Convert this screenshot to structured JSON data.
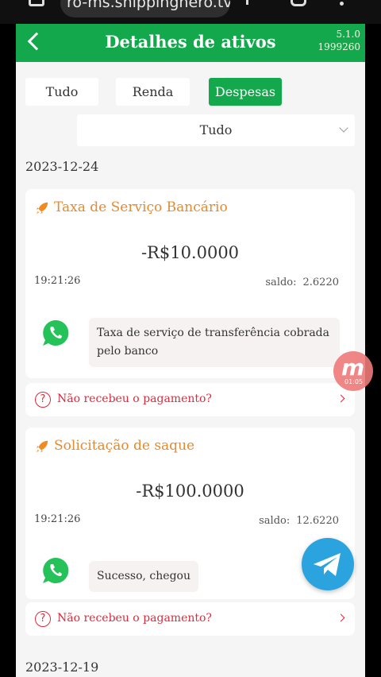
{
  "browser": {
    "url": "ro-ms.shippinghero.tv/#"
  },
  "header": {
    "title": "Detalhes de ativos",
    "version": "5.1.0",
    "build": "1999260"
  },
  "tabs": [
    {
      "label": "Tudo",
      "active": false
    },
    {
      "label": "Renda",
      "active": false
    },
    {
      "label": "Despesas",
      "active": true
    }
  ],
  "filter": {
    "selected": "Tudo"
  },
  "groups": [
    {
      "date": "2023-12-24",
      "records": [
        {
          "title": "Taxa de Serviço Bancário",
          "amount": "-R$10.0000",
          "time": "19:21:26",
          "saldo_label": "saldo:",
          "saldo_value": "2.6220",
          "message": "Taxa de serviço de transferência cobrada pelo banco",
          "help": "Não recebeu o pagamento?"
        },
        {
          "title": "Solicitação de saque",
          "amount": "-R$100.0000",
          "time": "19:21:26",
          "saldo_label": "saldo:",
          "saldo_value": "12.6220",
          "message": "Sucesso, chegou",
          "help": "Não recebeu o pagamento?"
        }
      ]
    },
    {
      "date": "2023-12-19",
      "records": []
    }
  ],
  "overlay": {
    "badge_letter": "m",
    "badge_time": "01:05"
  },
  "colors": {
    "brand_green": "#12a84b",
    "accent_orange": "#e68a2e",
    "alert_red": "#e0293c",
    "telegram_blue": "#2aa3df"
  }
}
